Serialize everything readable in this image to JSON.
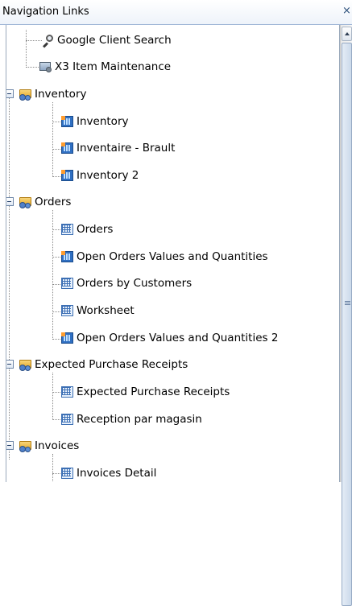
{
  "panel": {
    "title": "Navigation Links",
    "close_glyph": "×"
  },
  "tree": {
    "items": [
      {
        "label": "Google Client Search",
        "icon": "search-icon"
      },
      {
        "label": "X3 Item Maintenance",
        "icon": "screen-gear-icon"
      },
      {
        "label": "Inventory",
        "icon": "folder-gear-icon",
        "expanded": true
      },
      {
        "label": "Inventory",
        "icon": "report-icon"
      },
      {
        "label": "Inventaire - Brault",
        "icon": "report-icon"
      },
      {
        "label": "Inventory 2",
        "icon": "report-icon"
      },
      {
        "label": "Orders",
        "icon": "folder-gear-icon",
        "expanded": true
      },
      {
        "label": "Orders",
        "icon": "table-icon"
      },
      {
        "label": "Open Orders Values and Quantities",
        "icon": "report-icon"
      },
      {
        "label": "Orders by Customers",
        "icon": "table-icon"
      },
      {
        "label": "Worksheet",
        "icon": "table-icon"
      },
      {
        "label": "Open Orders Values and Quantities 2",
        "icon": "report-icon"
      },
      {
        "label": "Expected Purchase Receipts",
        "icon": "folder-gear-icon",
        "expanded": true
      },
      {
        "label": "Expected Purchase Receipts",
        "icon": "table-icon"
      },
      {
        "label": "Reception par magasin",
        "icon": "table-icon"
      },
      {
        "label": "Invoices",
        "icon": "folder-gear-icon",
        "expanded": true
      },
      {
        "label": "Invoices Detail",
        "icon": "table-icon"
      }
    ]
  },
  "colors": {
    "header_border": "#9fb6d6",
    "tree_line": "#8a8a8a",
    "folder": "#e3a82c",
    "report_blue": "#2f6fc2"
  }
}
